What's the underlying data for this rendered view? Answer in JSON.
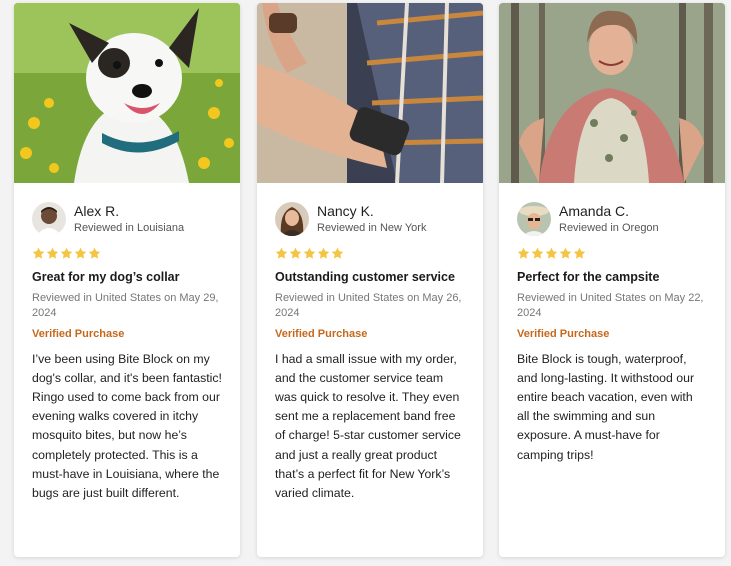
{
  "colors": {
    "star": "#f4c542",
    "verified": "#c4691c"
  },
  "reviews": [
    {
      "photo_icon": "dog-photo",
      "avatar_icon": "man-avatar",
      "name": "Alex R.",
      "location": "Reviewed in Louisiana",
      "stars": 5,
      "title": "Great for my dog’s collar",
      "date": "Reviewed in United States on May 29, 2024",
      "verified": "Verified Purchase",
      "text": "I’ve been using Bite Block on my dog's collar, and it's been fantastic! Ringo used to come back from our evening walks covered in itchy mosquito bites, but now he’s completely protected. This is a must-have in Louisiana, where the bugs are just built different."
    },
    {
      "photo_icon": "wristband-photo",
      "avatar_icon": "woman-avatar",
      "name": "Nancy K.",
      "location": "Reviewed in New York",
      "stars": 5,
      "title": "Outstanding customer service",
      "date": "Reviewed in United States on May 26, 2024",
      "verified": "Verified Purchase",
      "text": "I had a small issue with my order, and the customer service team was quick to resolve it. They even sent me a replacement band free of charge! 5-star customer service and just a really great product that’s a perfect fit for New York’s varied climate."
    },
    {
      "photo_icon": "woman-outdoors-photo",
      "avatar_icon": "woman-hat-avatar",
      "name": "Amanda C.",
      "location": "Reviewed in Oregon",
      "stars": 5,
      "title": "Perfect for the campsite",
      "date": "Reviewed in United States on May 22, 2024",
      "verified": "Verified Purchase",
      "text": "Bite Block is tough, waterproof, and long-lasting. It withstood our entire beach vacation, even with all the swimming and sun exposure. A must-have for camping trips!"
    }
  ]
}
